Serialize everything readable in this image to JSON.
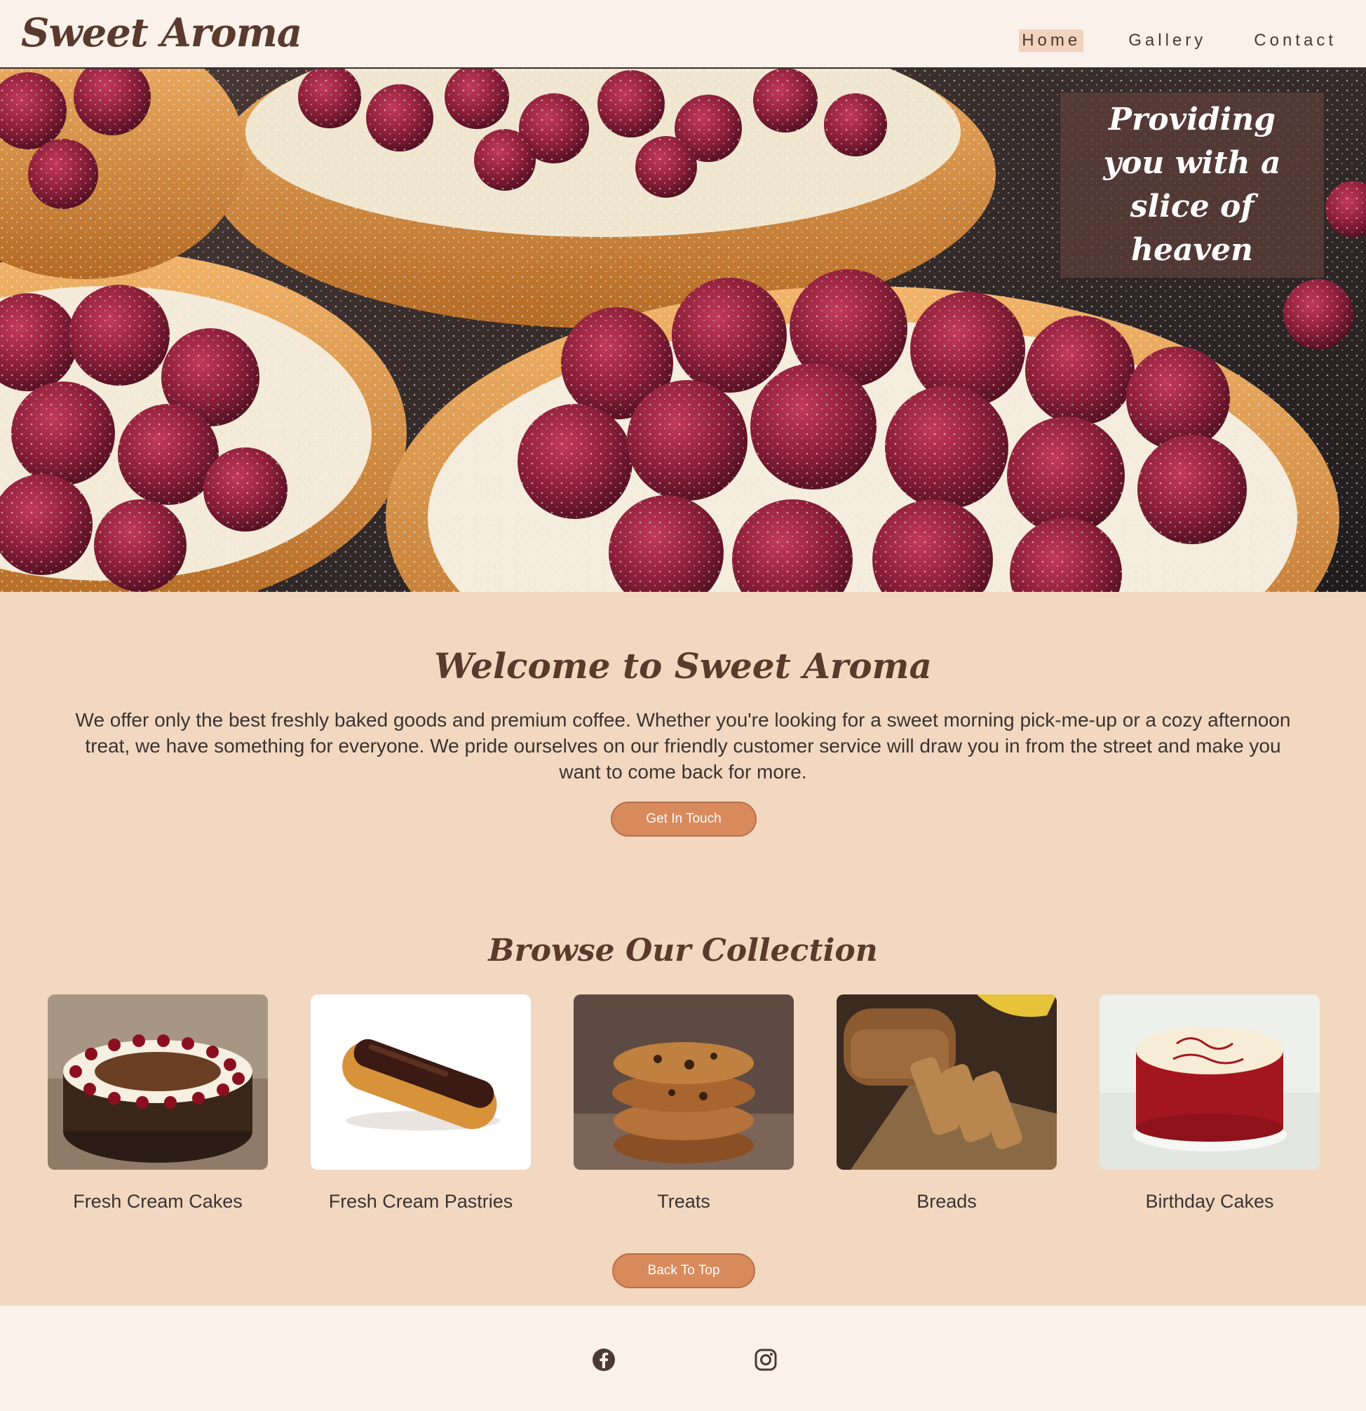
{
  "header": {
    "logo": "Sweet Aroma",
    "nav": [
      {
        "label": "Home",
        "active": true
      },
      {
        "label": "Gallery",
        "active": false
      },
      {
        "label": "Contact",
        "active": false
      }
    ]
  },
  "hero": {
    "tagline": "Providing you with a slice of heaven"
  },
  "welcome": {
    "title": "Welcome to Sweet Aroma",
    "text": "We offer only the best freshly baked goods and premium coffee. Whether you're looking for a sweet morning pick-me-up or a cozy afternoon treat, we have something for everyone. We pride ourselves on our friendly customer service will draw you in from the street and make you want to come back for more.",
    "button": "Get In Touch"
  },
  "collection": {
    "title": "Browse Our Collection",
    "items": [
      {
        "label": "Fresh Cream Cakes"
      },
      {
        "label": "Fresh Cream Pastries"
      },
      {
        "label": "Treats"
      },
      {
        "label": "Breads"
      },
      {
        "label": "Birthday Cakes"
      }
    ],
    "back_to_top": "Back To Top"
  },
  "footer": {
    "icons": [
      "facebook-icon",
      "instagram-icon"
    ]
  },
  "colors": {
    "brand": "#5b3a2e",
    "page_bg": "#f2d8c1",
    "header_bg": "#faf1ea",
    "button": "#d98a5c"
  }
}
